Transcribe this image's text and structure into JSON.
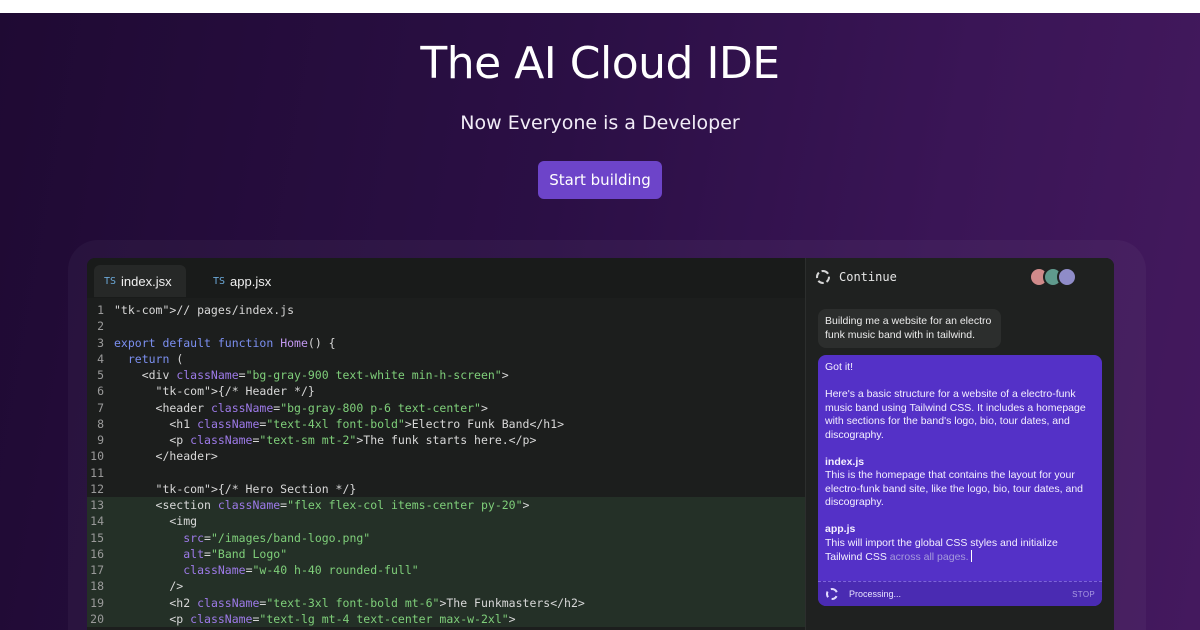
{
  "hero": {
    "title": "The AI Cloud IDE",
    "subtitle": "Now Everyone is a Developer",
    "cta_label": "Start building"
  },
  "colors": {
    "background_gradient": [
      "#1f0a33",
      "#44195e"
    ],
    "accent": "#6d44c9",
    "assistant_card": "#5431c7",
    "editor_bg": "#1c1e1d"
  },
  "editor": {
    "tabs": [
      {
        "lang": "TS",
        "label": "index.jsx",
        "active": true
      },
      {
        "lang": "TS",
        "label": "app.jsx",
        "active": false
      }
    ],
    "highlighted_lines": [
      13,
      14,
      15,
      16,
      17,
      18,
      19,
      20
    ],
    "lines": [
      {
        "n": "1",
        "text": "// pages/index.js"
      },
      {
        "n": "2",
        "text": ""
      },
      {
        "n": "3",
        "text": "export default function Home() {"
      },
      {
        "n": "4",
        "text": "  return ("
      },
      {
        "n": "5",
        "text": "    <div className=\"bg-gray-900 text-white min-h-screen\">"
      },
      {
        "n": "6",
        "text": "      {/* Header */}"
      },
      {
        "n": "7",
        "text": "      <header className=\"bg-gray-800 p-6 text-center\">"
      },
      {
        "n": "8",
        "text": "        <h1 className=\"text-4xl font-bold\">Electro Funk Band</h1>"
      },
      {
        "n": "9",
        "text": "        <p className=\"text-sm mt-2\">The funk starts here.</p>"
      },
      {
        "n": "10",
        "text": "      </header>"
      },
      {
        "n": "11",
        "text": ""
      },
      {
        "n": "12",
        "text": "      {/* Hero Section */}"
      },
      {
        "n": "13",
        "text": "      <section className=\"flex flex-col items-center py-20\">"
      },
      {
        "n": "14",
        "text": "        <img"
      },
      {
        "n": "15",
        "text": "          src=\"/images/band-logo.png\""
      },
      {
        "n": "16",
        "text": "          alt=\"Band Logo\""
      },
      {
        "n": "17",
        "text": "          className=\"w-40 h-40 rounded-full\""
      },
      {
        "n": "18",
        "text": "        />"
      },
      {
        "n": "19",
        "text": "        <h2 className=\"text-3xl font-bold mt-6\">The Funkmasters</h2>"
      },
      {
        "n": "20",
        "text": "        <p className=\"text-lg mt-4 text-center max-w-2xl\">"
      }
    ]
  },
  "chat": {
    "header_label": "Continue",
    "avatar_icons": [
      "avatar-1",
      "avatar-2",
      "avatar-3"
    ],
    "user_message": "Building me a website for an electro funk music band with in tailwind.",
    "assistant": {
      "greeting": "Got it!",
      "intro": "Here's a basic structure for a website of a electro-funk music band using Tailwind CSS. It includes a homepage with sections for the band's logo, bio, tour dates, and discography.",
      "file1_name": "index.js",
      "file1_desc": "This is the homepage that contains the layout for your electro-funk band site, like the logo, bio, tour dates, and discography.",
      "file2_name": "app.js",
      "file2_desc_solid": "This will import the global CSS styles and initialize Tailwind CSS",
      "file2_desc_fading": "across all pages."
    },
    "status": {
      "label": "Processing...",
      "stop_label": "STOP"
    }
  }
}
